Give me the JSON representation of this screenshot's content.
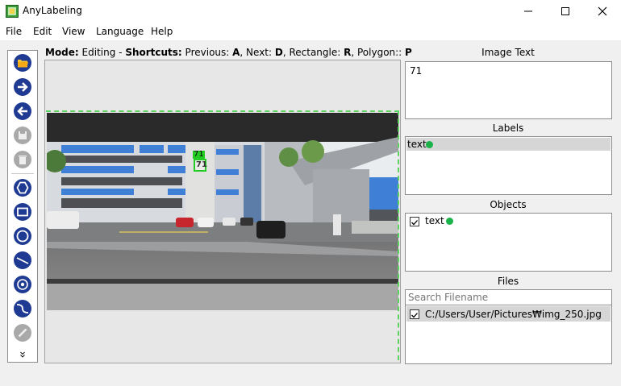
{
  "window": {
    "title": "AnyLabeling"
  },
  "menu": [
    "File",
    "Edit",
    "View",
    "Language",
    "Help"
  ],
  "modebar": {
    "mode_label": "Mode:",
    "mode_value": "Editing",
    "separator": " - ",
    "shortcuts_label": "Shortcuts:",
    "shortcuts_text": " Previous: ",
    "k1": "A",
    "t2": ", Next: ",
    "k2": "D",
    "t3": ", Rectangle: ",
    "k3": "R",
    "t4": ", Polygon:: ",
    "k4": "P"
  },
  "toolbar": {
    "icons": [
      "open-folder-icon",
      "next-image-icon",
      "previous-image-icon",
      "save-icon",
      "delete-icon",
      "polygon-icon",
      "rectangle-icon",
      "circle-icon",
      "line-icon",
      "point-icon",
      "linestrip-icon",
      "edit-pencil-icon",
      "expand-more-icon"
    ]
  },
  "canvas": {
    "annotation_label": "71",
    "sign_text": "71"
  },
  "image_text": {
    "title": "Image Text",
    "value": "71"
  },
  "labels": {
    "title": "Labels",
    "items": [
      {
        "name": "text",
        "color": "#1bb24a"
      }
    ]
  },
  "objects": {
    "title": "Objects",
    "items": [
      {
        "name": "text",
        "checked": true,
        "color": "#1bb24a"
      }
    ]
  },
  "files": {
    "title": "Files",
    "search_placeholder": "Search Filename",
    "items": [
      {
        "path": "C:/Users/User/Pictures₩img_250.jpg",
        "checked": true
      }
    ]
  },
  "colors": {
    "accent": "#1f3a93",
    "label_green": "#1bb24a",
    "box_green": "#22cc22"
  }
}
